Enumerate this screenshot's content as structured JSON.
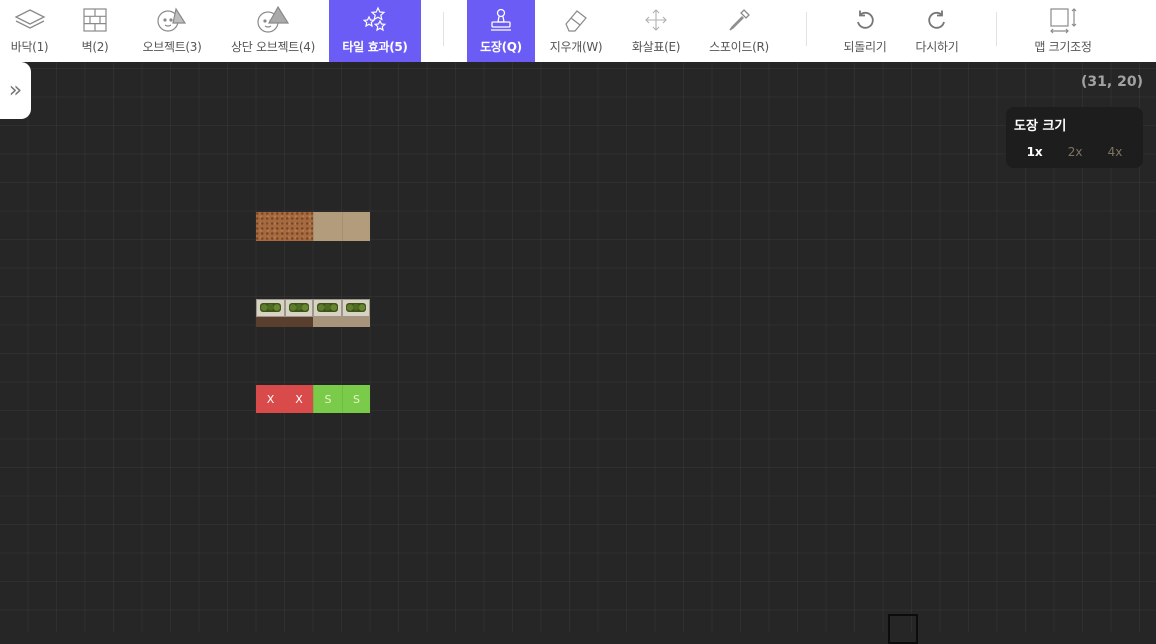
{
  "toolbar": {
    "layers": [
      {
        "label": "바닥(1)",
        "icon": "floor-layers-icon"
      },
      {
        "label": "벽(2)",
        "icon": "brick-wall-icon"
      },
      {
        "label": "오브젝트(3)",
        "icon": "object-character-icon"
      },
      {
        "label": "상단 오브젝트(4)",
        "icon": "top-object-character-icon"
      },
      {
        "label": "타일 효과(5)",
        "icon": "stars-effect-icon",
        "active": true
      }
    ],
    "tools": [
      {
        "label": "도장(Q)",
        "icon": "stamp-icon",
        "active": true
      },
      {
        "label": "지우개(W)",
        "icon": "eraser-icon"
      },
      {
        "label": "화살표(E)",
        "icon": "move-arrows-icon"
      },
      {
        "label": "스포이드(R)",
        "icon": "eyedropper-icon"
      }
    ],
    "history": [
      {
        "label": "되돌리기",
        "icon": "undo-icon"
      },
      {
        "label": "다시하기",
        "icon": "redo-icon"
      }
    ],
    "resize": {
      "label": "맵 크기조정",
      "icon": "resize-map-icon"
    }
  },
  "canvas": {
    "coords": "(31, 20)",
    "panel_toggle": "»"
  },
  "stamp_size": {
    "title": "도장 크기",
    "options": [
      "1x",
      "2x",
      "4x"
    ],
    "selected": "1x"
  },
  "tiles": {
    "block_marker": "X",
    "spawn_marker": "S"
  },
  "colors": {
    "accent": "#6b5cf6",
    "block": "#d94a4a",
    "spawn": "#7acb4a"
  }
}
